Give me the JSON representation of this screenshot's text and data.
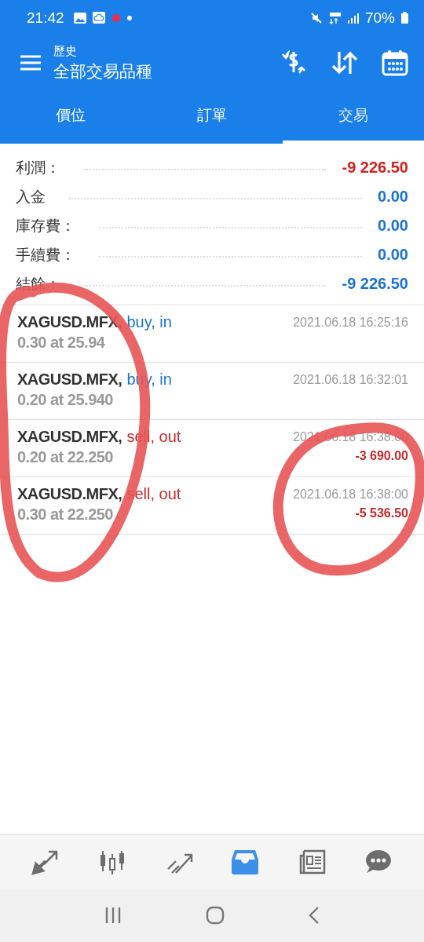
{
  "status_bar": {
    "time": "21:42",
    "battery": "70%"
  },
  "toolbar": {
    "subtitle": "歷史",
    "title": "全部交易品種"
  },
  "tabs": [
    {
      "label": "價位",
      "selected": false
    },
    {
      "label": "訂單",
      "selected": false
    },
    {
      "label": "交易",
      "selected": true
    }
  ],
  "summary": [
    {
      "label": "利潤：",
      "value": "-9 226.50",
      "color": "#d32020"
    },
    {
      "label": "入金",
      "value": "0.00",
      "color": "#1a73d0"
    },
    {
      "label": "庫存費：",
      "value": "0.00",
      "color": "#1a73d0"
    },
    {
      "label": "手續費：",
      "value": "0.00",
      "color": "#1a73d0"
    },
    {
      "label": "結餘：",
      "value": "-9 226.50",
      "color": "#1a73d0"
    }
  ],
  "deals": [
    {
      "symbol": "XAGUSD.MFX,",
      "action": "buy, in",
      "kind": "buy",
      "time": "2021.06.18 16:25:16",
      "volume": "0.30 at 25.94"
    },
    {
      "symbol": "XAGUSD.MFX,",
      "action": "buy, in",
      "kind": "buy",
      "time": "2021.06.18 16:32:01",
      "volume": "0.20 at 25.940"
    },
    {
      "symbol": "XAGUSD.MFX,",
      "action": "sell, out",
      "kind": "sell",
      "time": "2021.06.18 16:38:00",
      "volume": "0.20 at 22.250",
      "profit": "-3 690.00"
    },
    {
      "symbol": "XAGUSD.MFX,",
      "action": "sell, out",
      "kind": "sell",
      "time": "2021.06.18 16:38:00",
      "volume": "0.30 at 22.250",
      "profit": "-5 536.50"
    }
  ],
  "bottom_nav": [
    {
      "kind": "quotes",
      "selected": false
    },
    {
      "kind": "chart",
      "selected": false
    },
    {
      "kind": "trade",
      "selected": false
    },
    {
      "kind": "history",
      "selected": true
    },
    {
      "kind": "news",
      "selected": false
    },
    {
      "kind": "chat",
      "selected": false
    }
  ]
}
